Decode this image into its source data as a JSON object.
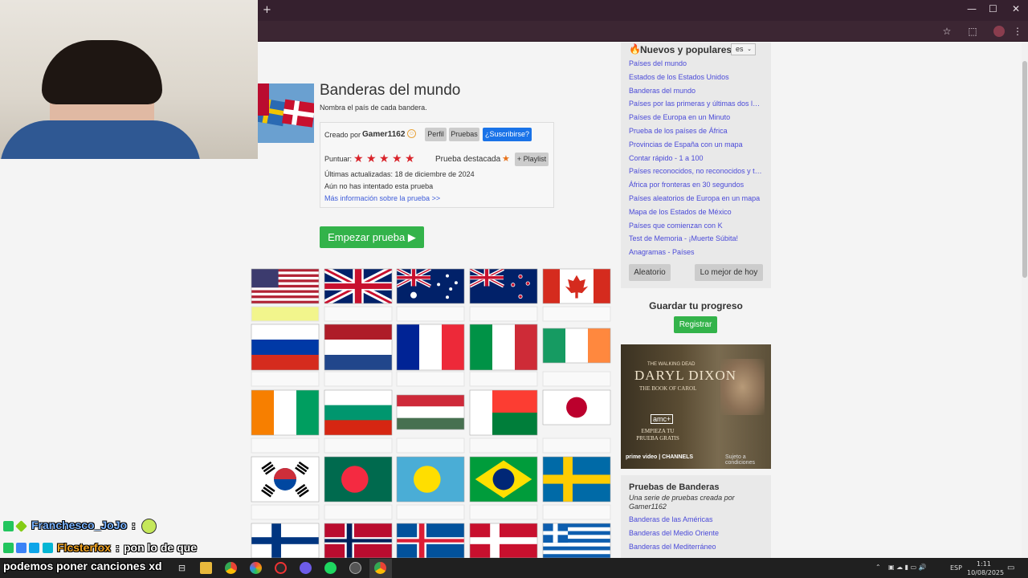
{
  "browser": {
    "new_tab_symbol": "+",
    "window_controls": [
      "—",
      "☐",
      "✕"
    ],
    "toolbar_icons": [
      "star-icon",
      "extensions-icon",
      "profile-icon",
      "menu-icon"
    ]
  },
  "quiz": {
    "title": "Banderas del mundo",
    "subtitle": "Nombra el país de cada bandera.",
    "created_by_label": "Creado por",
    "author": "Gamer1162",
    "profile_btn": "Perfil",
    "quizzes_btn": "Pruebas",
    "subscribe_btn": "¿Suscribirse?",
    "rate_label": "Puntuar:",
    "stars": 5,
    "featured_label": "Prueba destacada",
    "playlist_btn": "+ Playlist",
    "updated": "Últimas actualizadas: 18 de diciembre de 2024",
    "not_attempted": "Aún no has intentado esta prueba",
    "more_info": "Más información sobre la prueba >>",
    "start_btn": "Empezar prueba ▶"
  },
  "flags": [
    "usa",
    "uk",
    "australia",
    "new-zealand",
    "canada",
    "russia",
    "netherlands",
    "france",
    "italy",
    "ireland",
    "ivory-coast",
    "bulgaria",
    "hungary",
    "madagascar",
    "japan",
    "south-korea",
    "bangladesh",
    "palau",
    "brazil",
    "sweden",
    "finland",
    "norway",
    "iceland",
    "denmark",
    "greece"
  ],
  "sidebar": {
    "header": "Nuevos y populares",
    "lang": "es",
    "links": [
      "Países del mundo",
      "Estados de los Estados Unidos",
      "Banderas del mundo",
      "Países por las primeras y últimas dos let…",
      "Países de Europa en un Minuto",
      "Prueba de los países de África",
      "Provincias de España con un mapa",
      "Contar rápido - 1 a 100",
      "Países reconocidos, no reconocidos y te…",
      "África por fronteras en 30 segundos",
      "Países aleatorios de Europa en un mapa",
      "Mapa de los Estados de México",
      "Países que comienzan con K",
      "Test de Memoria - ¡Muerte Súbita!",
      "Anagramas - Países"
    ],
    "random_btn": "Aleatorio",
    "best_btn": "Lo mejor de hoy",
    "save_title": "Guardar tu progreso",
    "register_btn": "Registrar"
  },
  "ad": {
    "show": "THE WALKING DEAD",
    "title": "DARYL DIXON",
    "subtitle": "THE BOOK OF CAROL",
    "network": "amc+",
    "cta": "EMPIEZA TU PRUEBA GRATIS",
    "platform": "prime video | CHANNELS",
    "terms": "Sujeto a condiciones"
  },
  "series": {
    "title": "Pruebas de Banderas",
    "desc": "Una serie de pruebas creada por Gamer1162",
    "links": [
      "Banderas de las Américas",
      "Banderas del Medio Oriente",
      "Banderas del Mediterráneo"
    ]
  },
  "chat": [
    {
      "user": "Franchesco_JoJo",
      "sep": ":",
      "msg": ""
    },
    {
      "user": "Flcsterfox",
      "sep": ":",
      "msg": "pon lo de que"
    },
    {
      "user": "",
      "sep": "",
      "msg": "podemos poner canciones xd"
    }
  ],
  "tray": {
    "lang": "ESP",
    "time": "1:11",
    "date": "10/08/2025"
  }
}
